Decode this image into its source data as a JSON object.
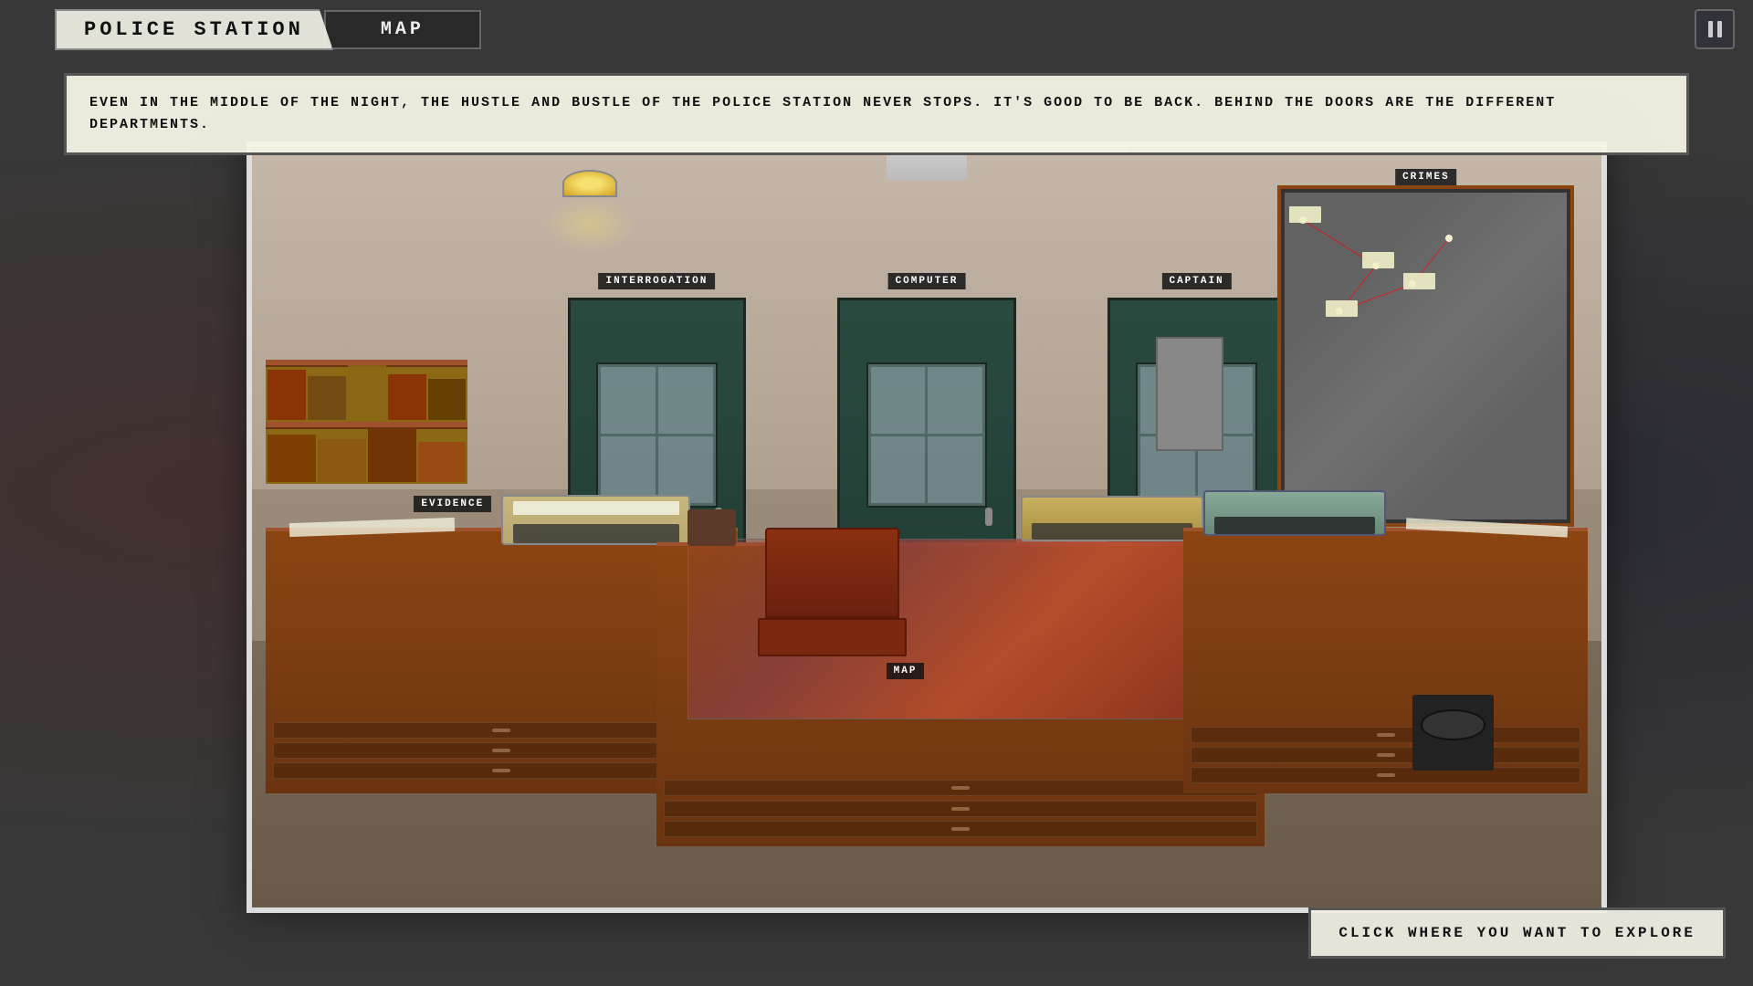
{
  "header": {
    "title": "POLICE STATION",
    "map_label": "MAP",
    "pause_label": "⏸"
  },
  "narration": {
    "text": "EVEN IN THE MIDDLE OF THE NIGHT, THE HUSTLE AND BUSTLE OF THE POLICE STATION NEVER STOPS. IT'S GOOD TO BE BACK. BEHIND THE DOORS ARE THE DIFFERENT DEPARTMENTS."
  },
  "scene": {
    "doors": [
      {
        "label": "INTERROGATION"
      },
      {
        "label": "COMPUTER"
      },
      {
        "label": "CAPTAIN"
      }
    ],
    "hotspots": [
      {
        "label": "EVIDENCE"
      },
      {
        "label": "CRIMES"
      },
      {
        "label": "MAP"
      }
    ]
  },
  "ui": {
    "explore_cta": "CLICK WHERE YOU WANT TO EXPLORE"
  }
}
